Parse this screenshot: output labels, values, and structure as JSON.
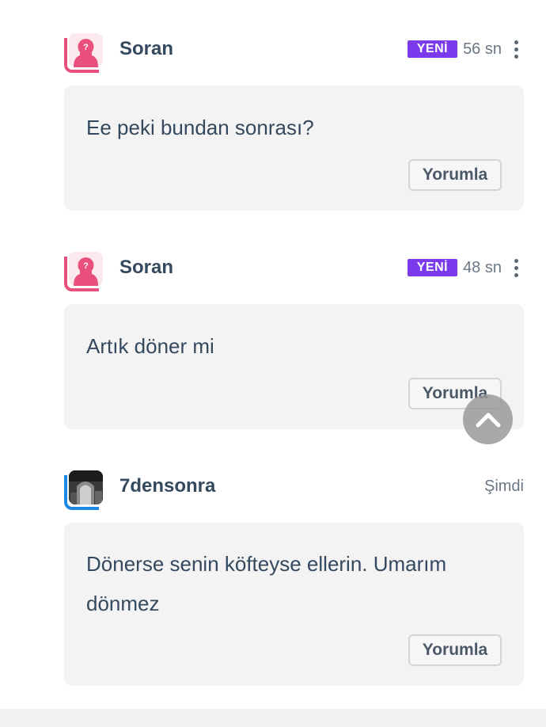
{
  "comments": [
    {
      "username": "Soran",
      "badge": "YENİ",
      "time": "56 sn",
      "text": "Ee peki bundan sonrası?",
      "reply_label": "Yorumla"
    },
    {
      "username": "Soran",
      "badge": "YENİ",
      "time": "48 sn",
      "text": "Artık döner mi",
      "reply_label": "Yorumla"
    },
    {
      "username": "7densonra",
      "time": "Şimdi",
      "text": "Dönerse senin köfteyse ellerin. Umarım dönmez",
      "reply_label": "Yorumla"
    }
  ],
  "colors": {
    "badge_bg": "#7c3aed",
    "asker_accent": "#e84f7d",
    "user_accent": "#1e88e5",
    "text": "#34495e"
  },
  "icons": {
    "asker_avatar": "anonymous-woman-question-icon",
    "menu": "kebab-menu-icon",
    "scroll_top": "chevron-up-icon"
  }
}
